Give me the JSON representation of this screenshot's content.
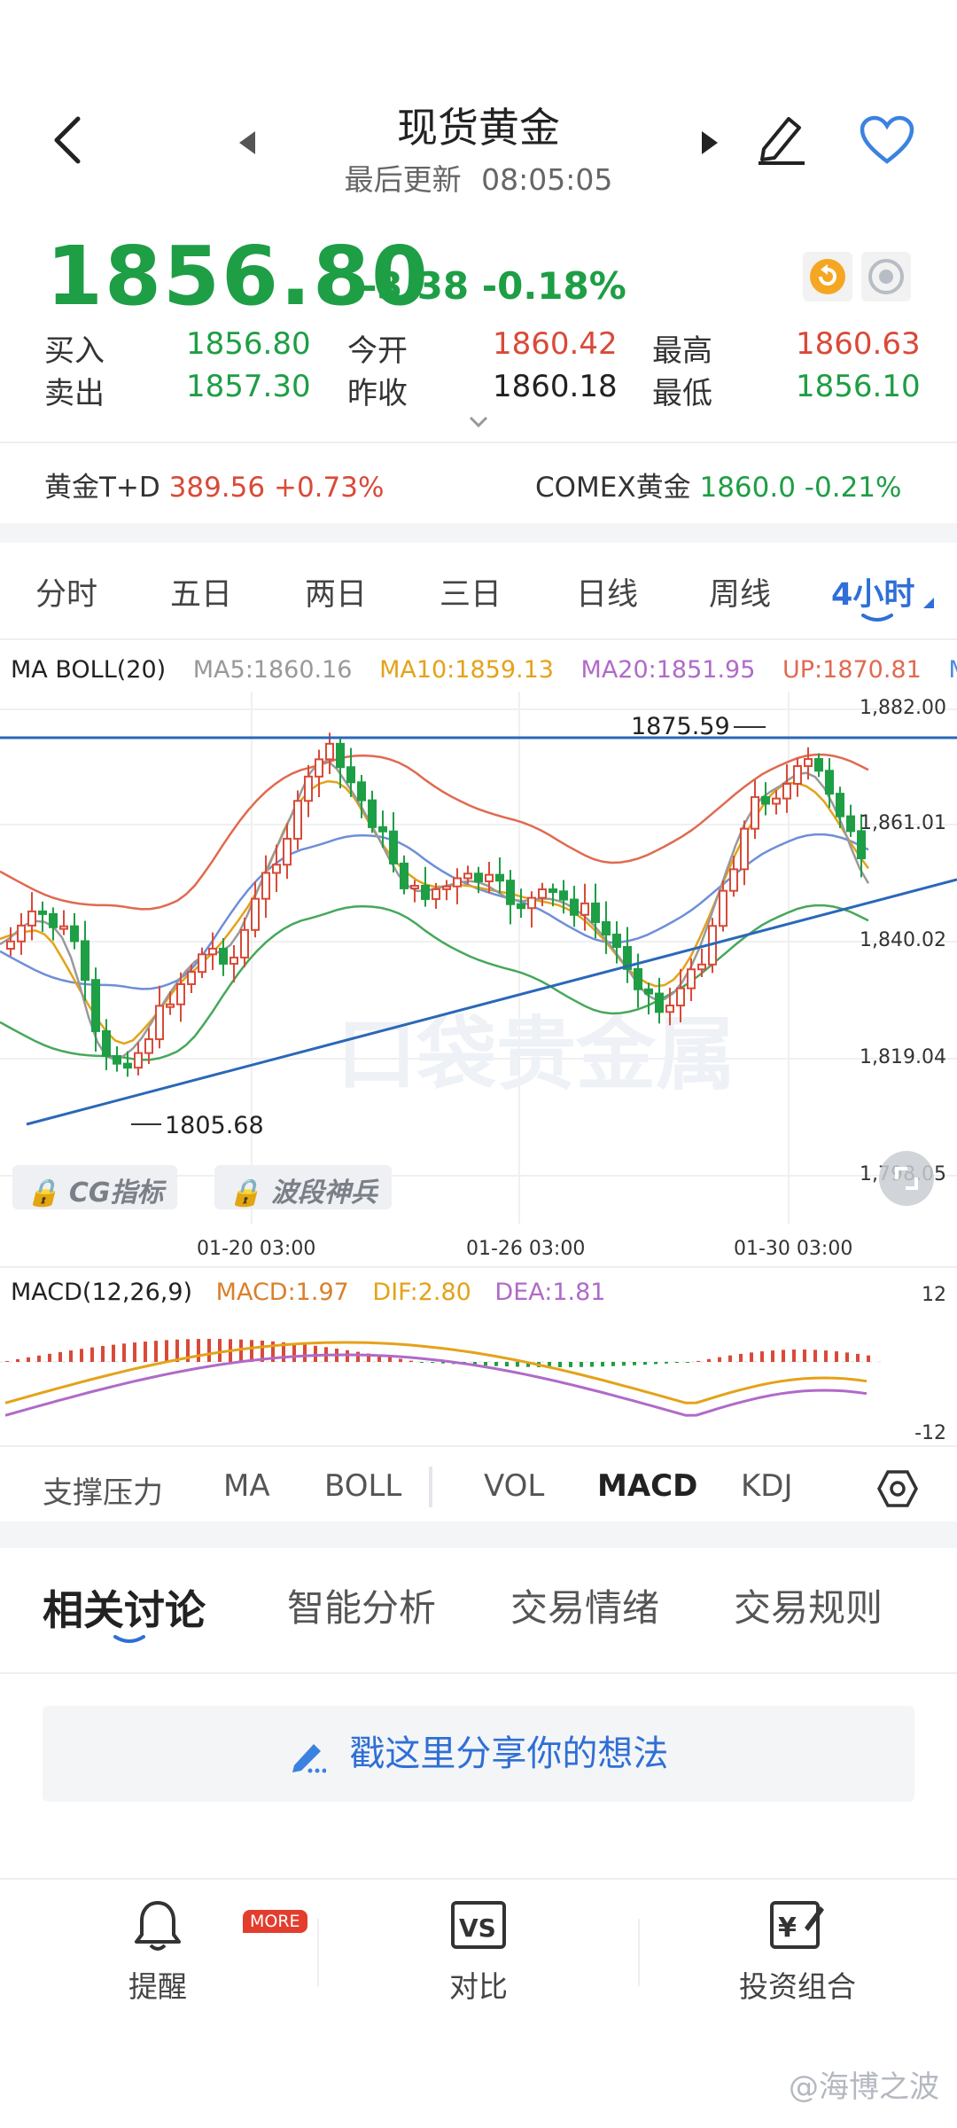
{
  "header": {
    "title": "现货黄金",
    "update_label": "最后更新",
    "update_time": "08:05:05"
  },
  "quote": {
    "price": "1856.80",
    "change": "-3.38",
    "change_pct": "-0.18%",
    "buy_label": "买入",
    "buy": "1856.80",
    "sell_label": "卖出",
    "sell": "1857.30",
    "open_label": "今开",
    "open": "1860.42",
    "prev_close_label": "昨收",
    "prev_close": "1860.18",
    "high_label": "最高",
    "high": "1860.63",
    "low_label": "最低",
    "low": "1856.10"
  },
  "related": {
    "td_name": "黄金T+D",
    "td_value": "389.56 +0.73%",
    "comex_name": "COMEX黄金",
    "comex_value": "1860.0 -0.21%"
  },
  "period_tabs": [
    "分时",
    "五日",
    "两日",
    "三日",
    "日线",
    "周线",
    "4小时"
  ],
  "active_period": 6,
  "indicators": {
    "name": "MA BOLL(20)",
    "ma5": "MA5:1860.16",
    "ma10": "MA10:1859.13",
    "ma20": "MA20:1851.95",
    "up": "UP:1870.81",
    "mid_partial": "MII"
  },
  "chart": {
    "y_labels": [
      "1,882.00",
      "1,861.01",
      "1,840.02",
      "1,819.04",
      "1,798.05"
    ],
    "x_labels": [
      "01-20 03:00",
      "01-26 03:00",
      "01-30 03:00"
    ],
    "high_mark": "1875.59",
    "low_mark": "1805.68",
    "watermark": "口袋贵金属",
    "lock_buttons": [
      "CG指标",
      "波段神兵"
    ]
  },
  "macd": {
    "name": "MACD(12,26,9)",
    "macd": "MACD:1.97",
    "dif": "DIF:2.80",
    "dea": "DEA:1.81",
    "y_top": "12",
    "y_bottom": "-12"
  },
  "indicator_tabs": [
    "支撑压力",
    "MA",
    "BOLL",
    "VOL",
    "MACD",
    "KDJ"
  ],
  "active_indicator": 4,
  "section_tabs": [
    "相关讨论",
    "智能分析",
    "交易情绪",
    "交易规则"
  ],
  "share_placeholder": "戳这里分享你的想法",
  "bottom_nav": {
    "remind": "提醒",
    "more_badge": "MORE",
    "compare": "对比",
    "portfolio": "投资组合"
  },
  "colors": {
    "green": "#1e9e45",
    "red": "#d94a38",
    "blue": "#2f6fd6",
    "ma5": "#999999",
    "ma10": "#e4a21a",
    "ma20": "#b06ac8",
    "boll_up": "#e06a50"
  },
  "footer_watermark": "@海博之波"
}
